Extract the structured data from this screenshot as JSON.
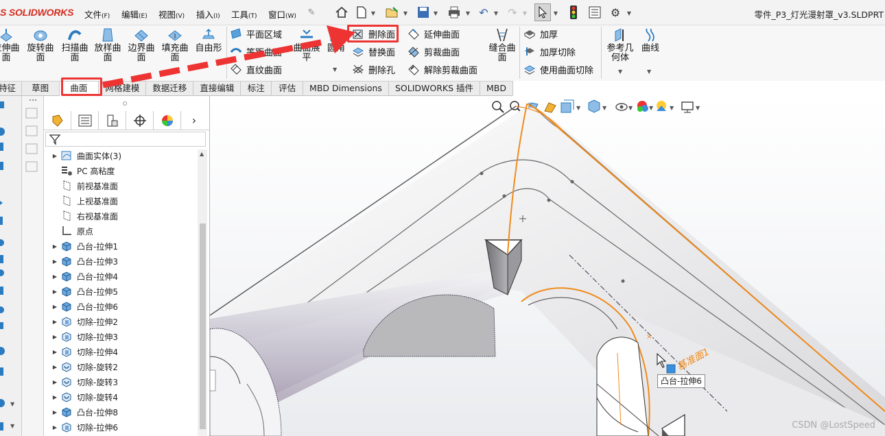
{
  "app": {
    "logo": "SOLIDWORKS",
    "logo_prefix": "S",
    "document_title": "零件_P3_灯光漫射罩_v3.SLDPRT"
  },
  "menu": [
    {
      "label": "文件",
      "key": "(F)"
    },
    {
      "label": "编辑",
      "key": "(E)"
    },
    {
      "label": "视图",
      "key": "(V)"
    },
    {
      "label": "插入",
      "key": "(I)"
    },
    {
      "label": "工具",
      "key": "(T)"
    },
    {
      "label": "窗口",
      "key": "(W)"
    }
  ],
  "quick_toolbar": [
    "home-icon",
    "new-document-icon",
    "open-icon",
    "save-icon",
    "print-icon",
    "undo-icon",
    "redo-icon",
    "select-cursor-icon",
    "traffic-light-icon",
    "options-list-icon",
    "gear-icon"
  ],
  "ribbon": {
    "big_buttons": [
      {
        "label": "拉伸曲面",
        "icon": "extruded-surface-icon"
      },
      {
        "label": "旋转曲面",
        "icon": "revolved-surface-icon"
      },
      {
        "label": "扫描曲面",
        "icon": "swept-surface-icon"
      },
      {
        "label": "放样曲面",
        "icon": "lofted-surface-icon"
      },
      {
        "label": "边界曲面",
        "icon": "boundary-surface-icon"
      },
      {
        "label": "填充曲面",
        "icon": "filled-surface-icon"
      },
      {
        "label": "自由形",
        "icon": "freeform-icon"
      }
    ],
    "group2": [
      "平面区域",
      "等距曲面",
      "直纹曲面"
    ],
    "mid_big": [
      {
        "label": "曲面展平",
        "icon": "surface-flatten-icon"
      },
      {
        "label": "圆角",
        "icon": "fillet-icon"
      }
    ],
    "group3": [
      "删除面",
      "替换面",
      "删除孔"
    ],
    "group4": [
      "延伸曲面",
      "剪裁曲面",
      "解除剪裁曲面"
    ],
    "knit": {
      "label": "缝合曲面",
      "icon": "knit-surface-icon"
    },
    "group5": [
      "加厚",
      "加厚切除",
      "使用曲面切除"
    ],
    "ref_geom": "参考几何体",
    "curves": "曲线"
  },
  "tabs": [
    "特征",
    "草图",
    "曲面",
    "网格建模",
    "数据迁移",
    "直接编辑",
    "标注",
    "评估",
    "MBD Dimensions",
    "SOLIDWORKS 插件",
    "MBD"
  ],
  "active_tab": "曲面",
  "tree": {
    "items": [
      {
        "label": "曲面实体(3)",
        "expandable": true,
        "icon": "surface-bodies-icon"
      },
      {
        "label": "PC 高粘度",
        "expandable": false,
        "icon": "material-icon"
      },
      {
        "label": "前视基准面",
        "expandable": false,
        "icon": "plane-icon"
      },
      {
        "label": "上视基准面",
        "expandable": false,
        "icon": "plane-icon"
      },
      {
        "label": "右视基准面",
        "expandable": false,
        "icon": "plane-icon"
      },
      {
        "label": "原点",
        "expandable": false,
        "icon": "origin-icon"
      },
      {
        "label": "凸台-拉伸1",
        "expandable": true,
        "icon": "boss-extrude-icon"
      },
      {
        "label": "凸台-拉伸3",
        "expandable": true,
        "icon": "boss-extrude-icon"
      },
      {
        "label": "凸台-拉伸4",
        "expandable": true,
        "icon": "boss-extrude-icon"
      },
      {
        "label": "凸台-拉伸5",
        "expandable": true,
        "icon": "boss-extrude-icon"
      },
      {
        "label": "凸台-拉伸6",
        "expandable": true,
        "icon": "boss-extrude-icon"
      },
      {
        "label": "切除-拉伸2",
        "expandable": true,
        "icon": "cut-extrude-icon"
      },
      {
        "label": "切除-拉伸3",
        "expandable": true,
        "icon": "cut-extrude-icon"
      },
      {
        "label": "切除-拉伸4",
        "expandable": true,
        "icon": "cut-extrude-icon"
      },
      {
        "label": "切除-旋转2",
        "expandable": true,
        "icon": "cut-revolve-icon"
      },
      {
        "label": "切除-旋转3",
        "expandable": true,
        "icon": "cut-revolve-icon"
      },
      {
        "label": "切除-旋转4",
        "expandable": true,
        "icon": "cut-revolve-icon"
      },
      {
        "label": "凸台-拉伸8",
        "expandable": true,
        "icon": "boss-extrude-icon"
      },
      {
        "label": "切除-拉伸6",
        "expandable": true,
        "icon": "cut-extrude-icon"
      }
    ]
  },
  "viewport": {
    "tooltip": "凸台-拉伸6",
    "plane_label": "基准面1"
  },
  "watermark": "CSDN @LostSpeed",
  "colors": {
    "logo_red": "#d52b1e",
    "highlight_red": "#e33333",
    "selection_orange": "#f08a1c",
    "ribbon_icon_blue": "#2a7bbf"
  }
}
